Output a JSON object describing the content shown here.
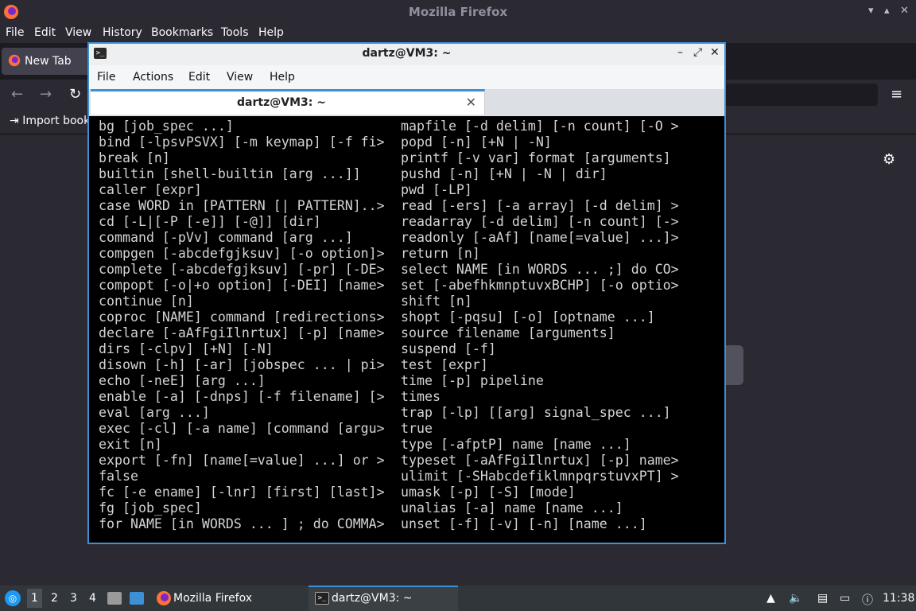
{
  "firefox": {
    "title": "Mozilla Firefox",
    "menu": [
      "File",
      "Edit",
      "View",
      "History",
      "Bookmarks",
      "Tools",
      "Help"
    ],
    "tab_label": "New Tab",
    "bookmark_import_label": "Import book",
    "nav_icons": [
      "back-arrow-icon",
      "forward-arrow-icon",
      "reload-icon",
      "hamburger-menu-icon"
    ]
  },
  "terminal": {
    "title": "dartz@VM3: ~",
    "menu": [
      "File",
      "Actions",
      "Edit",
      "View",
      "Help"
    ],
    "tab_label": "dartz@VM3: ~",
    "lines_left": [
      "bg [job_spec ...]",
      "bind [-lpsvPSVX] [-m keymap] [-f fi>",
      "break [n]",
      "builtin [shell-builtin [arg ...]]",
      "caller [expr]",
      "case WORD in [PATTERN [| PATTERN]..>",
      "cd [-L|[-P [-e]] [-@]] [dir]",
      "command [-pVv] command [arg ...]",
      "compgen [-abcdefgjksuv] [-o option]>",
      "complete [-abcdefgjksuv] [-pr] [-DE>",
      "compopt [-o|+o option] [-DEI] [name>",
      "continue [n]",
      "coproc [NAME] command [redirections>",
      "declare [-aAfFgiIlnrtux] [-p] [name>",
      "dirs [-clpv] [+N] [-N]",
      "disown [-h] [-ar] [jobspec ... | pi>",
      "echo [-neE] [arg ...]",
      "enable [-a] [-dnps] [-f filename] [>",
      "eval [arg ...]",
      "exec [-cl] [-a name] [command [argu>",
      "exit [n]",
      "export [-fn] [name[=value] ...] or >",
      "false",
      "fc [-e ename] [-lnr] [first] [last]>",
      "fg [job_spec]",
      "for NAME [in WORDS ... ] ; do COMMA>"
    ],
    "lines_right": [
      "mapfile [-d delim] [-n count] [-O >",
      "popd [-n] [+N | -N]",
      "printf [-v var] format [arguments]",
      "pushd [-n] [+N | -N | dir]",
      "pwd [-LP]",
      "read [-ers] [-a array] [-d delim] >",
      "readarray [-d delim] [-n count] [->",
      "readonly [-aAf] [name[=value] ...]>",
      "return [n]",
      "select NAME [in WORDS ... ;] do CO>",
      "set [-abefhkmnptuvxBCHP] [-o optio>",
      "shift [n]",
      "shopt [-pqsu] [-o] [optname ...]",
      "source filename [arguments]",
      "suspend [-f]",
      "test [expr]",
      "time [-p] pipeline",
      "times",
      "trap [-lp] [[arg] signal_spec ...]",
      "true",
      "type [-afptP] name [name ...]",
      "typeset [-aAfFgiIlnrtux] [-p] name>",
      "ulimit [-SHabcdefiklmnpqrstuvxPT] >",
      "umask [-p] [-S] [mode]",
      "unalias [-a] name [name ...]",
      "unset [-f] [-v] [-n] [name ...]"
    ]
  },
  "taskbar": {
    "workspaces": [
      "1",
      "2",
      "3",
      "4"
    ],
    "firefox_task_label": "Mozilla Firefox",
    "terminal_task_label": "dartz@VM3: ~",
    "clock": "11:38"
  },
  "colors": {
    "accent": "#3d8fd6",
    "terminal_bg": "#000000",
    "terminal_fg": "#d3d3d3"
  }
}
